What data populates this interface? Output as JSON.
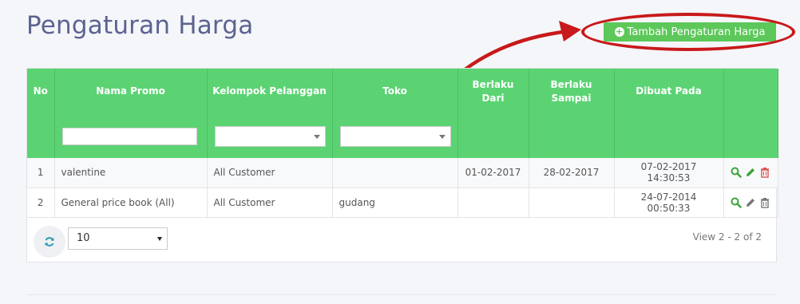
{
  "header": {
    "title": "Pengaturan Harga",
    "add_button_label": "Tambah Pengaturan Harga"
  },
  "table": {
    "columns": [
      "No",
      "Nama Promo",
      "Kelompok Pelanggan",
      "Toko",
      "Berlaku Dari",
      "Berlaku Sampai",
      "Dibuat Pada",
      ""
    ],
    "rows": [
      {
        "no": "1",
        "nama_promo": "valentine",
        "kelompok": "All Customer",
        "toko": "",
        "berlaku_dari": "01-02-2017",
        "berlaku_sampai": "28-02-2017",
        "dibuat_pada": "07-02-2017 14:30:53"
      },
      {
        "no": "2",
        "nama_promo": "General price book (All)",
        "kelompok": "All Customer",
        "toko": "gudang",
        "berlaku_dari": "",
        "berlaku_sampai": "",
        "dibuat_pada": "24-07-2014 00:50:33"
      }
    ]
  },
  "pager": {
    "page_size": "10",
    "view_text": "View 2 - 2 of 2"
  },
  "icons": {
    "add": "plus-circle-icon",
    "view": "search-icon",
    "edit": "pencil-icon",
    "delete": "trash-icon",
    "refresh": "refresh-icon"
  },
  "colors": {
    "header_green": "#5bd373",
    "button_green": "#5cc85a",
    "title": "#5c6391",
    "annotation_red": "#c8191b"
  }
}
